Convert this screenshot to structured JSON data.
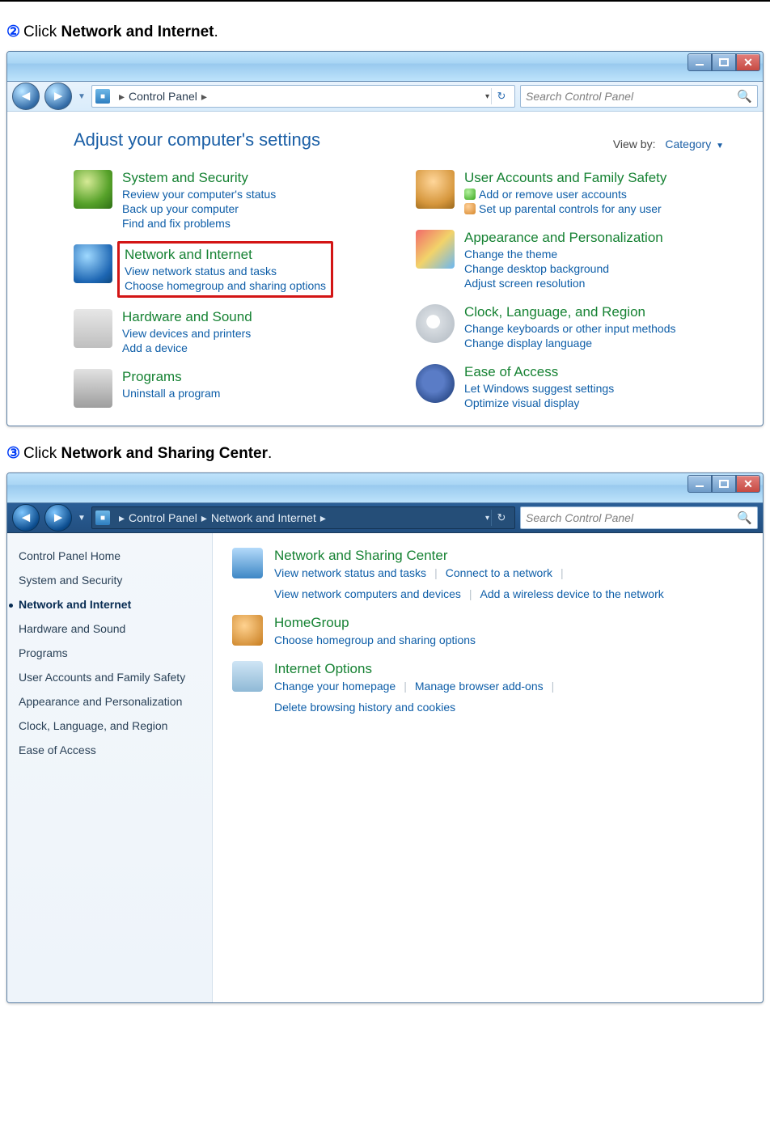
{
  "step2": {
    "num": "②",
    "pre": "Click ",
    "bold": "Network and Internet",
    "post": "."
  },
  "step3": {
    "num": "③",
    "pre": "Click ",
    "bold": "Network and Sharing Center",
    "post": "."
  },
  "searchPlaceholder": "Search Control Panel",
  "win1": {
    "breadcrumb": [
      "Control Panel"
    ],
    "title": "Adjust your computer's settings",
    "viewby": {
      "label": "View by:",
      "value": "Category"
    },
    "left": [
      {
        "head": "System and Security",
        "links": [
          "Review your computer's status",
          "Back up your computer",
          "Find and fix problems"
        ],
        "icon": "ic-shield"
      },
      {
        "head": "Network and Internet",
        "links": [
          "View network status and tasks",
          "Choose homegroup and sharing options"
        ],
        "icon": "ic-net",
        "hl": true
      },
      {
        "head": "Hardware and Sound",
        "links": [
          "View devices and printers",
          "Add a device"
        ],
        "icon": "ic-hw"
      },
      {
        "head": "Programs",
        "links": [
          "Uninstall a program"
        ],
        "icon": "ic-prog"
      }
    ],
    "right": [
      {
        "head": "User Accounts and Family Safety",
        "iconic": [
          "g",
          "o"
        ],
        "links": [
          "Add or remove user accounts",
          "Set up parental controls for any user"
        ],
        "icon": "ic-user"
      },
      {
        "head": "Appearance and Personalization",
        "links": [
          "Change the theme",
          "Change desktop background",
          "Adjust screen resolution"
        ],
        "icon": "ic-app"
      },
      {
        "head": "Clock, Language, and Region",
        "links": [
          "Change keyboards or other input methods",
          "Change display language"
        ],
        "icon": "ic-clock"
      },
      {
        "head": "Ease of Access",
        "links": [
          "Let Windows suggest settings",
          "Optimize visual display"
        ],
        "icon": "ic-ease"
      }
    ]
  },
  "win2": {
    "breadcrumb": [
      "Control Panel",
      "Network and Internet"
    ],
    "side": [
      "Control Panel Home",
      "System and Security",
      "Network and Internet",
      "Hardware and Sound",
      "Programs",
      "User Accounts and Family Safety",
      "Appearance and Personalization",
      "Clock, Language, and Region",
      "Ease of Access"
    ],
    "sideCurrent": 2,
    "main": [
      {
        "head": "Network and Sharing Center",
        "icon": "ic-nsc",
        "links": [
          "View network status and tasks",
          "Connect to a network",
          "View network computers and devices",
          "Add a wireless device to the network"
        ]
      },
      {
        "head": "HomeGroup",
        "icon": "ic-hg",
        "links": [
          "Choose homegroup and sharing options"
        ]
      },
      {
        "head": "Internet Options",
        "icon": "ic-io",
        "links": [
          "Change your homepage",
          "Manage browser add-ons",
          "Delete browsing history and cookies"
        ]
      }
    ]
  }
}
